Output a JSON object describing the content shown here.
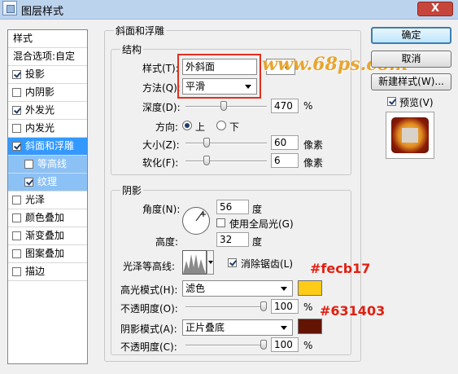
{
  "window": {
    "title": "图层样式",
    "close_glyph": "X"
  },
  "sidebar": {
    "items": [
      {
        "label": "样式"
      },
      {
        "label": "混合选项:自定"
      },
      {
        "label": "投影",
        "checked": true
      },
      {
        "label": "内阴影",
        "checked": false
      },
      {
        "label": "外发光",
        "checked": true
      },
      {
        "label": "内发光",
        "checked": false
      },
      {
        "label": "斜面和浮雕",
        "checked": true,
        "selected": true
      },
      {
        "label": "等高线",
        "checked": false,
        "sub": true
      },
      {
        "label": "纹理",
        "checked": true,
        "sub": true
      },
      {
        "label": "光泽",
        "checked": false
      },
      {
        "label": "颜色叠加",
        "checked": false
      },
      {
        "label": "渐变叠加",
        "checked": false
      },
      {
        "label": "图案叠加",
        "checked": false
      },
      {
        "label": "描边",
        "checked": false
      }
    ]
  },
  "bevel": {
    "section_title": "斜面和浮雕",
    "structure": {
      "title": "结构",
      "style_label": "样式(T):",
      "style_value": "外斜面",
      "technique_label": "方法(Q):",
      "technique_value": "平滑",
      "depth_label": "深度(D):",
      "depth_value": "470",
      "depth_unit": "%",
      "direction_label": "方向:",
      "direction_up": "上",
      "direction_down": "下",
      "size_label": "大小(Z):",
      "size_value": "60",
      "size_unit": "像素",
      "soften_label": "软化(F):",
      "soften_value": "6",
      "soften_unit": "像素"
    },
    "shading": {
      "title": "阴影",
      "angle_label": "角度(N):",
      "angle_value": "56",
      "angle_unit": "度",
      "global_light_label": "使用全局光(G)",
      "altitude_label": "高度:",
      "altitude_value": "32",
      "altitude_unit": "度",
      "gloss_contour_label": "光泽等高线:",
      "anti_alias_label": "消除锯齿(L)",
      "highlight_mode_label": "高光模式(H):",
      "highlight_mode_value": "滤色",
      "highlight_opacity_label": "不透明度(O):",
      "highlight_opacity_value": "100",
      "highlight_opacity_unit": "%",
      "shadow_mode_label": "阴影模式(A):",
      "shadow_mode_value": "正片叠底",
      "shadow_opacity_label": "不透明度(C):",
      "shadow_opacity_value": "100",
      "shadow_opacity_unit": "%"
    }
  },
  "levels": {
    "depth": 0.47,
    "size": 0.24,
    "soften": 0.24,
    "highlight_opacity": 1.0,
    "shadow_opacity": 1.0
  },
  "buttons": {
    "ok": "确定",
    "cancel": "取消",
    "new_style": "新建样式(W)...",
    "preview": "预览(V)"
  },
  "annotations": {
    "highlight_color": "#fecb17",
    "shadow_color": "#631403",
    "watermark": "www.68ps.com"
  },
  "colors": {
    "highlight_swatch": "#fecb17",
    "shadow_swatch": "#631403",
    "accent": "#3399ff",
    "annotation": "#e02010"
  }
}
